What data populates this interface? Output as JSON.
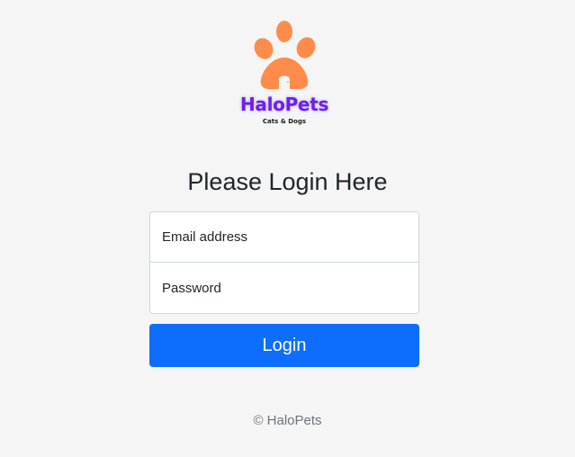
{
  "brand": {
    "name": "HaloPets",
    "tagline": "Cats & Dogs",
    "logo_icon": "paw-print-icon",
    "primary_color": "#6a22e6",
    "paw_color": "#ff8c4a"
  },
  "page": {
    "title": "Please Login Here"
  },
  "form": {
    "email_placeholder": "Email address",
    "email_value": "",
    "password_placeholder": "Password",
    "password_value": "",
    "login_label": "Login",
    "button_color": "#0d6efd"
  },
  "footer": {
    "text": "© HaloPets"
  }
}
